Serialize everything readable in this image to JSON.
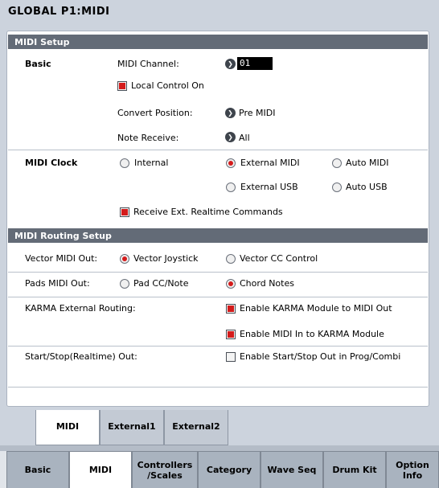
{
  "title": "GLOBAL P1:MIDI",
  "midi_setup": {
    "header": "MIDI Setup",
    "basic_label": "Basic",
    "midi_channel_label": "MIDI Channel:",
    "midi_channel_value": "01",
    "local_control_label": "Local Control On",
    "local_control_checked": true,
    "convert_position_label": "Convert Position:",
    "convert_position_value": "Pre MIDI",
    "note_receive_label": "Note Receive:",
    "note_receive_value": "All",
    "midi_clock_label": "MIDI Clock",
    "clock_options": {
      "internal": "Internal",
      "external_midi": "External MIDI",
      "auto_midi": "Auto MIDI",
      "external_usb": "External USB",
      "auto_usb": "Auto USB"
    },
    "clock_selected": "External MIDI",
    "receive_ext_label": "Receive Ext. Realtime Commands",
    "receive_ext_checked": true
  },
  "routing": {
    "header": "MIDI Routing Setup",
    "vector_out_label": "Vector MIDI Out:",
    "vector_joystick": "Vector Joystick",
    "vector_cc": "Vector CC Control",
    "vector_selected": "Vector Joystick",
    "pads_out_label": "Pads MIDI Out:",
    "pad_cc_note": "Pad CC/Note",
    "chord_notes": "Chord Notes",
    "pads_selected": "Chord Notes",
    "karma_routing_label": "KARMA External Routing:",
    "karma_to_midi": "Enable KARMA Module to MIDI Out",
    "karma_to_midi_checked": true,
    "midi_to_karma": "Enable MIDI In to KARMA Module",
    "midi_to_karma_checked": true,
    "start_stop_label": "Start/Stop(Realtime) Out:",
    "start_stop_enable": "Enable Start/Stop Out in Prog/Combi",
    "start_stop_checked": false
  },
  "sub_tabs": [
    "MIDI",
    "External1",
    "External2"
  ],
  "sub_tab_active": "MIDI",
  "page_tabs": [
    "Basic",
    "MIDI",
    "Controllers\n/Scales",
    "Category",
    "Wave Seq",
    "Drum Kit",
    "Option\nInfo"
  ],
  "page_tab_active": "MIDI",
  "colors": {
    "accent": "#d41b1b",
    "header_bg": "#636b77",
    "panel_bg": "#ccd3dd"
  }
}
